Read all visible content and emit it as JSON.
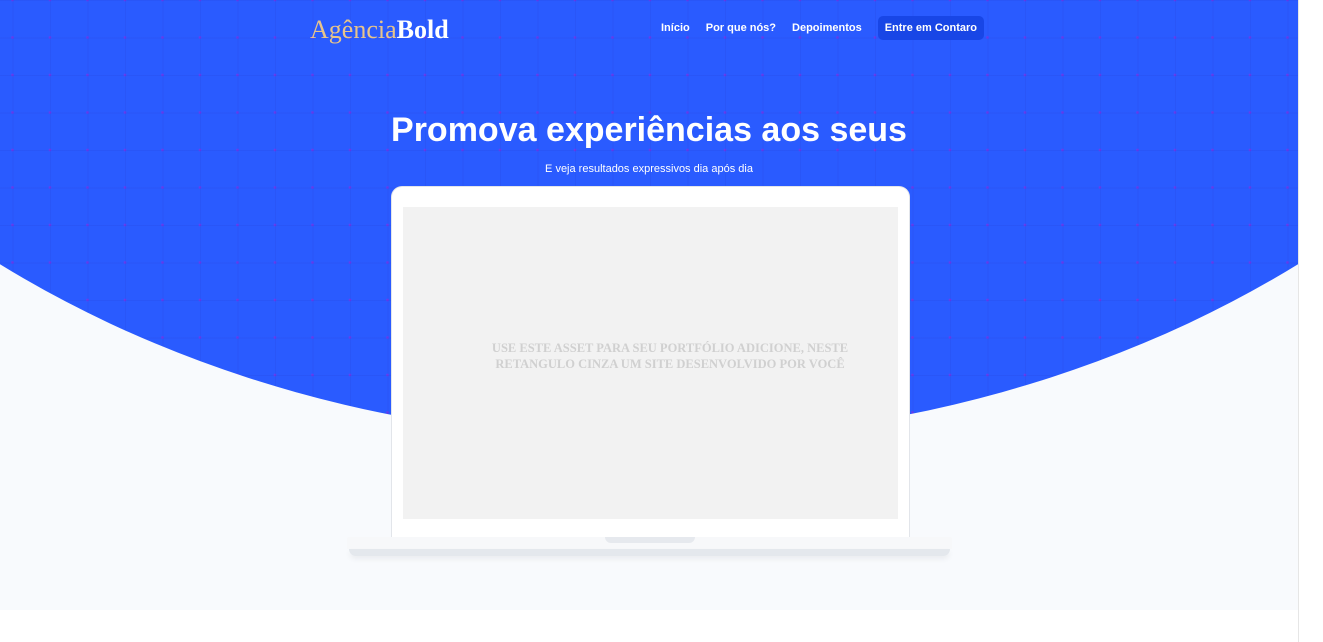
{
  "header": {
    "logo_part1": "Agência",
    "logo_part2": "Bold",
    "nav": {
      "home": "Início",
      "why_us": "Por que nós?",
      "testimonials": "Depoimentos",
      "contact": "Entre em Contaro"
    }
  },
  "hero": {
    "title": "Promova experiências aos seus",
    "subtitle": "E veja resultados expressivos dia após dia",
    "screen_line1": "USE ESTE ASSET PARA SEU PORTFÓLIO ADICIONE, NESTE",
    "screen_line2": "RETANGULO CINZA UM SITE DESENVOLVIDO POR VOCÊ"
  },
  "colors": {
    "primary_blue": "#2a5bff",
    "cta_blue": "#1846e6",
    "logo_gold": "#e8c48a",
    "background": "#f8fafd"
  }
}
